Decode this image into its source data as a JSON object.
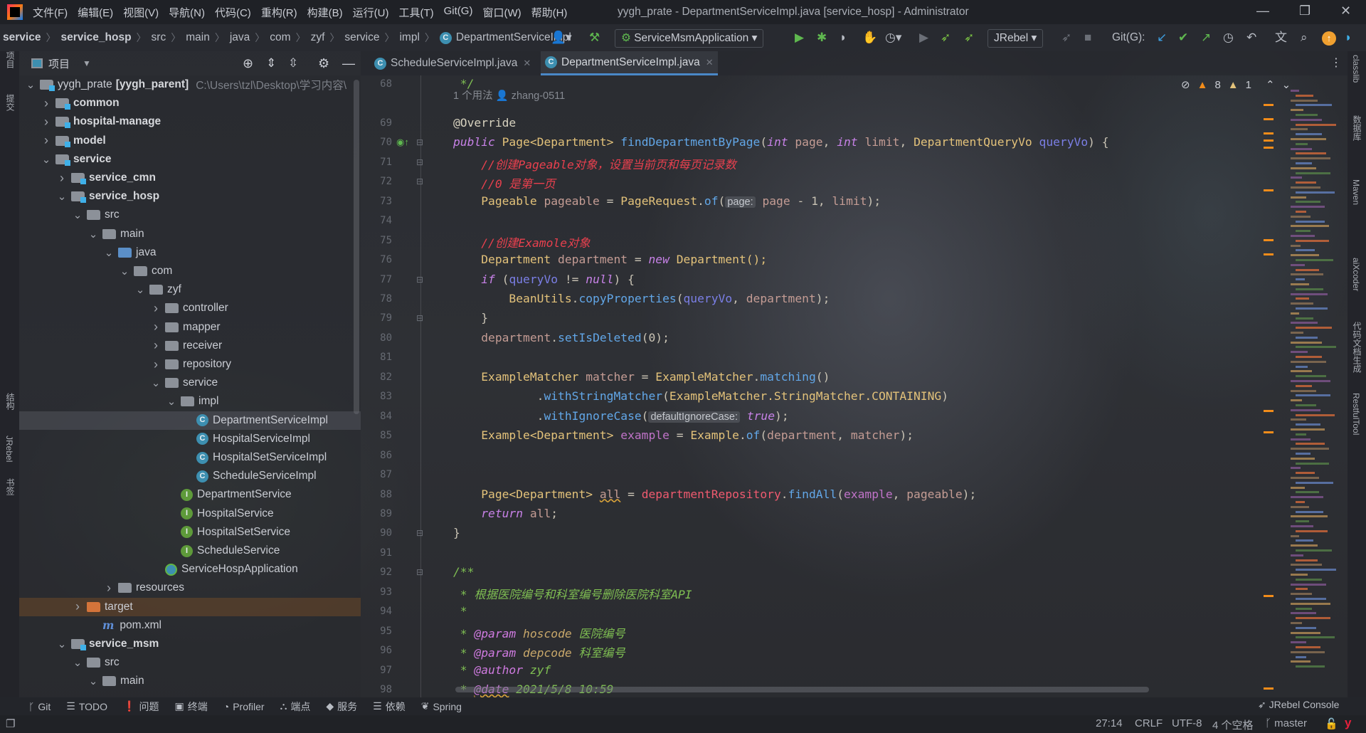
{
  "window": {
    "title": "yygh_prate - DepartmentServiceImpl.java [service_hosp] - Administrator"
  },
  "menu": [
    "文件(F)",
    "编辑(E)",
    "视图(V)",
    "导航(N)",
    "代码(C)",
    "重构(R)",
    "构建(B)",
    "运行(U)",
    "工具(T)",
    "Git(G)",
    "窗口(W)",
    "帮助(H)"
  ],
  "breadcrumb": [
    "service",
    "service_hosp",
    "src",
    "main",
    "java",
    "com",
    "zyf",
    "service",
    "impl",
    "DepartmentServiceImpl"
  ],
  "toolbar": {
    "run_config": "ServiceMsmApplication",
    "jrebel": "JRebel",
    "git_label": "Git(G):"
  },
  "left_stripe": [
    "项目",
    "提交",
    "结构",
    "JRebel",
    "书签"
  ],
  "right_stripe": [
    "classlib",
    "数据库",
    "Maven",
    "aiXcoder",
    "代码文档生成",
    "RestfulTool"
  ],
  "project": {
    "title": "项目",
    "tree": [
      {
        "l": 0,
        "label": "yygh_prate",
        "bold_suffix": "[yygh_parent]",
        "hint": "C:\\Users\\tzl\\Desktop\\学习内容\\",
        "icon": "module",
        "open": true
      },
      {
        "l": 1,
        "label": "common",
        "icon": "module",
        "open": false,
        "bold": true
      },
      {
        "l": 1,
        "label": "hospital-manage",
        "icon": "module",
        "open": false,
        "bold": true
      },
      {
        "l": 1,
        "label": "model",
        "icon": "module",
        "open": false,
        "bold": true
      },
      {
        "l": 1,
        "label": "service",
        "icon": "module",
        "open": true,
        "bold": true
      },
      {
        "l": 2,
        "label": "service_cmn",
        "icon": "module",
        "open": false,
        "bold": true
      },
      {
        "l": 2,
        "label": "service_hosp",
        "icon": "module",
        "open": true,
        "bold": true
      },
      {
        "l": 3,
        "label": "src",
        "icon": "folder",
        "open": true
      },
      {
        "l": 4,
        "label": "main",
        "icon": "folder",
        "open": true
      },
      {
        "l": 5,
        "label": "java",
        "icon": "src",
        "open": true
      },
      {
        "l": 6,
        "label": "com",
        "icon": "folder",
        "open": true
      },
      {
        "l": 7,
        "label": "zyf",
        "icon": "folder",
        "open": true
      },
      {
        "l": 8,
        "label": "controller",
        "icon": "folder",
        "open": false
      },
      {
        "l": 8,
        "label": "mapper",
        "icon": "folder",
        "open": false
      },
      {
        "l": 8,
        "label": "receiver",
        "icon": "folder",
        "open": false
      },
      {
        "l": 8,
        "label": "repository",
        "icon": "folder",
        "open": false
      },
      {
        "l": 8,
        "label": "service",
        "icon": "folder",
        "open": true
      },
      {
        "l": 9,
        "label": "impl",
        "icon": "folder",
        "open": true
      },
      {
        "l": 10,
        "label": "DepartmentServiceImpl",
        "icon": "class",
        "selected": true
      },
      {
        "l": 10,
        "label": "HospitalServiceImpl",
        "icon": "class"
      },
      {
        "l": 10,
        "label": "HospitalSetServiceImpl",
        "icon": "class"
      },
      {
        "l": 10,
        "label": "ScheduleServiceImpl",
        "icon": "class"
      },
      {
        "l": 9,
        "label": "DepartmentService",
        "icon": "interface"
      },
      {
        "l": 9,
        "label": "HospitalService",
        "icon": "interface"
      },
      {
        "l": 9,
        "label": "HospitalSetService",
        "icon": "interface"
      },
      {
        "l": 9,
        "label": "ScheduleService",
        "icon": "interface"
      },
      {
        "l": 8,
        "label": "ServiceHospApplication",
        "icon": "app"
      },
      {
        "l": 5,
        "label": "resources",
        "icon": "res",
        "open": false
      },
      {
        "l": 3,
        "label": "target",
        "icon": "target",
        "open": false,
        "excluded": true
      },
      {
        "l": 4,
        "label": "pom.xml",
        "icon": "maven"
      },
      {
        "l": 2,
        "label": "service_msm",
        "icon": "module",
        "open": true,
        "bold": true
      },
      {
        "l": 3,
        "label": "src",
        "icon": "folder",
        "open": true
      },
      {
        "l": 4,
        "label": "main",
        "icon": "folder",
        "open": true
      }
    ]
  },
  "tabs": [
    {
      "label": "ScheduleServiceImpl.java",
      "active": false
    },
    {
      "label": "DepartmentServiceImpl.java",
      "active": true
    }
  ],
  "inspections": {
    "warnings": "8",
    "weak_warnings": "1"
  },
  "usage_hint": {
    "usages": "1 个用法",
    "author": "zhang-0511"
  },
  "code": [
    {
      "n": "68",
      "tk": [
        [
          " */",
          "d"
        ]
      ]
    },
    {
      "n": "69",
      "tk": [
        [
          "@Override",
          "a"
        ]
      ]
    },
    {
      "n": "70",
      "tk": [
        [
          "public",
          "k"
        ],
        [
          " Page<Department> ",
          "t"
        ],
        [
          "findDepartmentByPage",
          "m"
        ],
        [
          "(",
          ""
        ],
        [
          "int",
          "k"
        ],
        [
          " ",
          ""
        ],
        [
          "page",
          "v"
        ],
        [
          ", ",
          ""
        ],
        [
          "int",
          "k"
        ],
        [
          " ",
          ""
        ],
        [
          "limit",
          "v"
        ],
        [
          ", ",
          ""
        ],
        [
          "DepartmentQueryVo ",
          "t"
        ],
        [
          "queryVo",
          "p"
        ],
        [
          ") {",
          ""
        ]
      ]
    },
    {
      "n": "71",
      "tk": [
        [
          "    ",
          ""
        ],
        [
          "//创建Pageable对象，设置当前页和每页记录数",
          "c"
        ]
      ]
    },
    {
      "n": "72",
      "tk": [
        [
          "    ",
          ""
        ],
        [
          "//0 是第一页",
          "c"
        ]
      ]
    },
    {
      "n": "73",
      "tk": [
        [
          "    Pageable ",
          "t"
        ],
        [
          "pageable",
          "v"
        ],
        [
          " = ",
          ""
        ],
        [
          "PageRequest",
          "t"
        ],
        [
          ".",
          ""
        ],
        [
          "of",
          "m"
        ],
        [
          "(",
          ""
        ],
        [
          "page:",
          "h"
        ],
        [
          " ",
          ""
        ],
        [
          "page",
          "v"
        ],
        [
          " - 1, ",
          ""
        ],
        [
          "limit",
          "v"
        ],
        [
          ");",
          ""
        ]
      ]
    },
    {
      "n": "74",
      "tk": []
    },
    {
      "n": "75",
      "tk": [
        [
          "    ",
          ""
        ],
        [
          "//创建Examole对象",
          "c"
        ]
      ]
    },
    {
      "n": "76",
      "tk": [
        [
          "    Department ",
          "t"
        ],
        [
          "department",
          "v"
        ],
        [
          " = ",
          ""
        ],
        [
          "new",
          "k"
        ],
        [
          " Department();",
          "t"
        ]
      ]
    },
    {
      "n": "77",
      "tk": [
        [
          "    ",
          ""
        ],
        [
          "if",
          "k"
        ],
        [
          " (",
          ""
        ],
        [
          "queryVo",
          "p"
        ],
        [
          " != ",
          ""
        ],
        [
          "null",
          "k"
        ],
        [
          ") {",
          ""
        ]
      ]
    },
    {
      "n": "78",
      "tk": [
        [
          "        BeanUtils",
          "t"
        ],
        [
          ".",
          ""
        ],
        [
          "copyProperties",
          "m"
        ],
        [
          "(",
          ""
        ],
        [
          "queryVo",
          "p"
        ],
        [
          ", ",
          ""
        ],
        [
          "department",
          "v"
        ],
        [
          ");",
          ""
        ]
      ]
    },
    {
      "n": "79",
      "tk": [
        [
          "    }",
          ""
        ]
      ]
    },
    {
      "n": "80",
      "tk": [
        [
          "    ",
          ""
        ],
        [
          "department",
          "v"
        ],
        [
          ".",
          ""
        ],
        [
          "setIsDeleted",
          "m"
        ],
        [
          "(0);",
          ""
        ]
      ]
    },
    {
      "n": "81",
      "tk": []
    },
    {
      "n": "82",
      "tk": [
        [
          "    ExampleMatcher ",
          "t"
        ],
        [
          "matcher",
          "v"
        ],
        [
          " = ",
          ""
        ],
        [
          "ExampleMatcher",
          "t"
        ],
        [
          ".",
          ""
        ],
        [
          "matching",
          "m"
        ],
        [
          "()",
          ""
        ]
      ]
    },
    {
      "n": "83",
      "tk": [
        [
          "            .",
          ""
        ],
        [
          "withStringMatcher",
          "m"
        ],
        [
          "(",
          ""
        ],
        [
          "ExampleMatcher.StringMatcher.CONTAINING",
          "t"
        ],
        [
          ")",
          ""
        ]
      ]
    },
    {
      "n": "84",
      "tk": [
        [
          "            .",
          ""
        ],
        [
          "withIgnoreCase",
          "m"
        ],
        [
          "(",
          ""
        ],
        [
          "defaultIgnoreCase:",
          "h"
        ],
        [
          " ",
          ""
        ],
        [
          "true",
          "k"
        ],
        [
          ");",
          ""
        ]
      ]
    },
    {
      "n": "85",
      "tk": [
        [
          "    Example<Department> ",
          "t"
        ],
        [
          "example",
          "e"
        ],
        [
          " = ",
          ""
        ],
        [
          "Example",
          "t"
        ],
        [
          ".",
          ""
        ],
        [
          "of",
          "m"
        ],
        [
          "(",
          ""
        ],
        [
          "department",
          "v"
        ],
        [
          ", ",
          ""
        ],
        [
          "matcher",
          "v"
        ],
        [
          ");",
          ""
        ]
      ]
    },
    {
      "n": "86",
      "tk": []
    },
    {
      "n": "87",
      "tk": []
    },
    {
      "n": "88",
      "tk": [
        [
          "    Page<Department> ",
          "t"
        ],
        [
          "all",
          "v w"
        ],
        [
          " = ",
          ""
        ],
        [
          "departmentRepository",
          "f"
        ],
        [
          ".",
          ""
        ],
        [
          "findAll",
          "m"
        ],
        [
          "(",
          ""
        ],
        [
          "example",
          "e"
        ],
        [
          ", ",
          ""
        ],
        [
          "pageable",
          "v"
        ],
        [
          ");",
          ""
        ]
      ]
    },
    {
      "n": "89",
      "tk": [
        [
          "    ",
          ""
        ],
        [
          "return",
          "k"
        ],
        [
          " ",
          ""
        ],
        [
          "all",
          "v"
        ],
        [
          ";",
          ""
        ]
      ]
    },
    {
      "n": "90",
      "tk": [
        [
          "}",
          ""
        ]
      ]
    },
    {
      "n": "91",
      "tk": []
    },
    {
      "n": "92",
      "tk": [
        [
          "/**",
          "d"
        ]
      ]
    },
    {
      "n": "93",
      "tk": [
        [
          " * 根据医院编号和科室编号删除医院科室API",
          "d"
        ]
      ]
    },
    {
      "n": "94",
      "tk": [
        [
          " *",
          "d"
        ]
      ]
    },
    {
      "n": "95",
      "tk": [
        [
          " * ",
          "d"
        ],
        [
          "@param",
          "dt"
        ],
        [
          " hoscode",
          "dp"
        ],
        [
          " 医院编号",
          "d"
        ]
      ]
    },
    {
      "n": "96",
      "tk": [
        [
          " * ",
          "d"
        ],
        [
          "@param",
          "dt"
        ],
        [
          " depcode",
          "dp"
        ],
        [
          " 科室编号",
          "d"
        ]
      ]
    },
    {
      "n": "97",
      "tk": [
        [
          " * ",
          "d"
        ],
        [
          "@author",
          "dt"
        ],
        [
          " zyf",
          "d"
        ]
      ]
    },
    {
      "n": "98",
      "tk": [
        [
          " * ",
          "d"
        ],
        [
          "@date",
          "dt w"
        ],
        [
          " 2021/5/8 10:59",
          "d"
        ]
      ]
    }
  ],
  "tool_windows": [
    "Git",
    "TODO",
    "问题",
    "终端",
    "Profiler",
    "端点",
    "服务",
    "依赖",
    "Spring"
  ],
  "jrebel_console": "JRebel Console",
  "status": {
    "position": "27:14",
    "line_sep": "CRLF",
    "encoding": "UTF-8",
    "indent": "4 个空格",
    "branch": "master"
  },
  "colors": {
    "accent": "#4a88c7",
    "keyword": "#c882e8",
    "comment": "#e8404e",
    "doc": "#7fbf52",
    "warning": "#f28c1a"
  }
}
